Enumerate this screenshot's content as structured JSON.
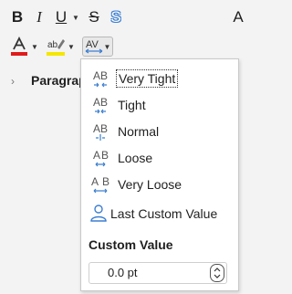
{
  "toolbar": {
    "bold_label": "B",
    "italic_label": "I",
    "underline_label": "U",
    "strike_label": "S",
    "shadow_label": "S",
    "a_label": "A"
  },
  "sidebar": {
    "section_label": "Paragrap"
  },
  "spacing_menu": {
    "items": [
      {
        "label": "Very Tight",
        "icon": "spacing-very-tight-icon"
      },
      {
        "label": "Tight",
        "icon": "spacing-tight-icon"
      },
      {
        "label": "Normal",
        "icon": "spacing-normal-icon"
      },
      {
        "label": "Loose",
        "icon": "spacing-loose-icon"
      },
      {
        "label": "Very Loose",
        "icon": "spacing-very-loose-icon"
      },
      {
        "label": "Last Custom Value",
        "icon": "person-icon"
      }
    ],
    "custom_title": "Custom Value",
    "custom_value": "0.0 pt"
  },
  "colors": {
    "font_color": "#e01b1b",
    "highlight_color": "#f5e600",
    "accent": "#3d7fd1"
  }
}
